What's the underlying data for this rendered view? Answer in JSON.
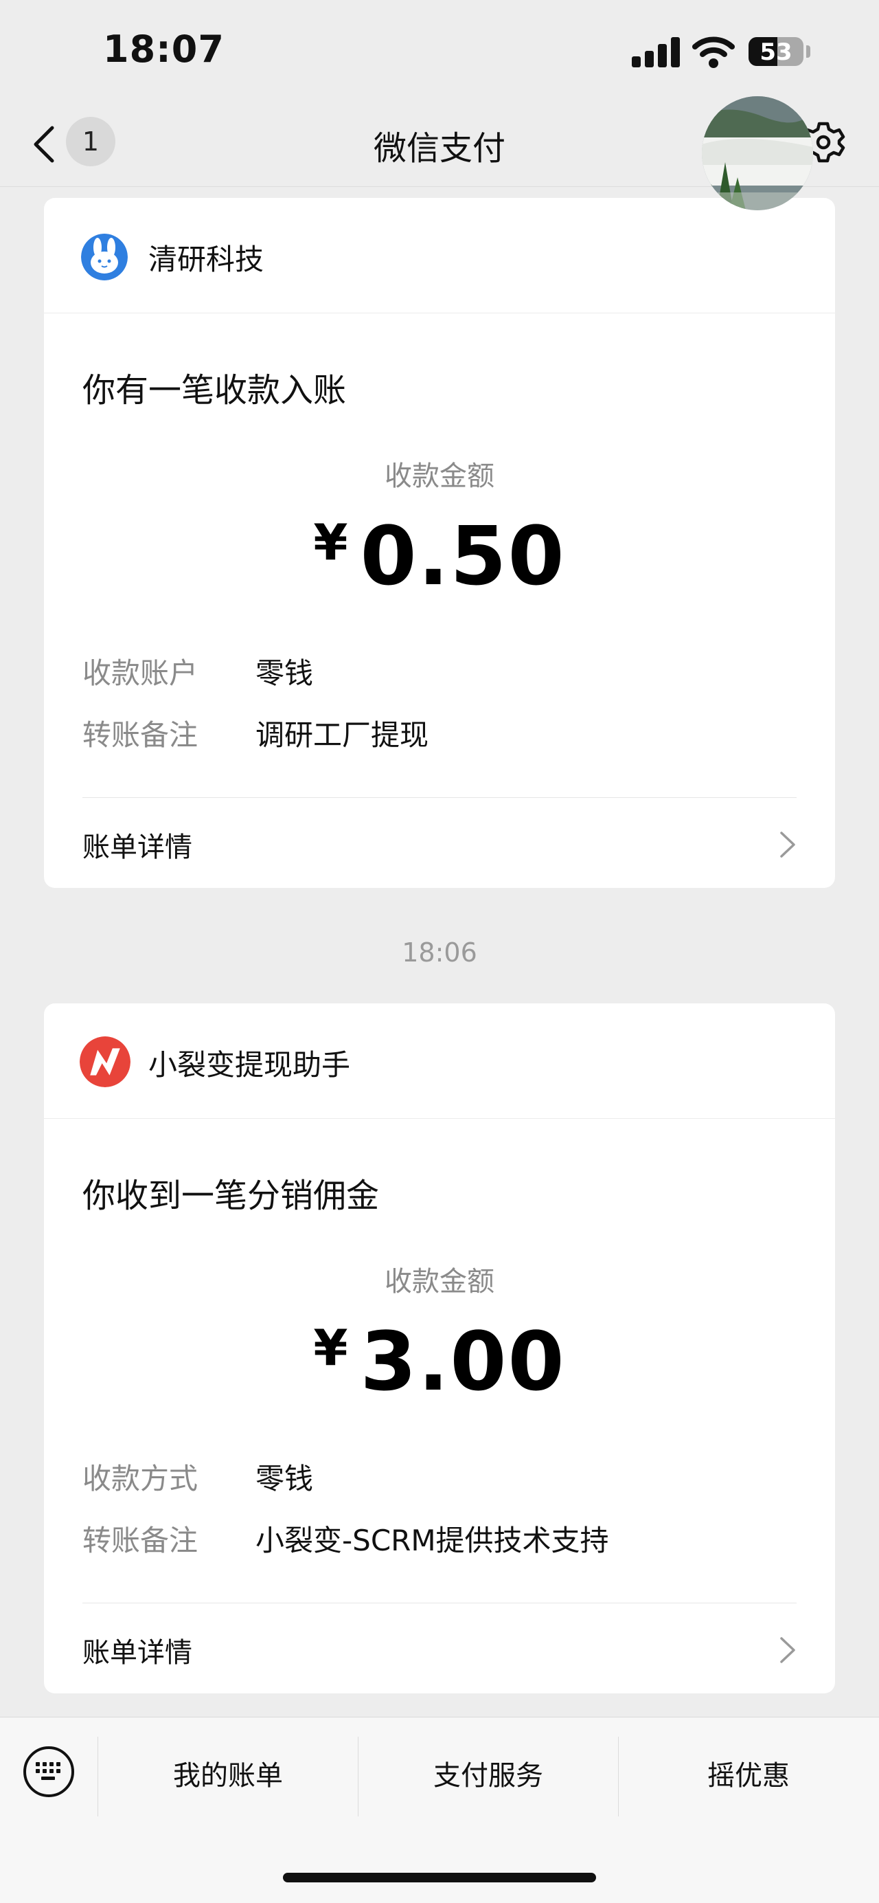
{
  "status_bar": {
    "time": "18:07",
    "battery": "53",
    "battery_level": 0.53
  },
  "nav": {
    "unread_count": "1",
    "title": "微信支付"
  },
  "messages": [
    {
      "sender": "清研科技",
      "headline": "你有一笔收款入账",
      "amount_label": "收款金额",
      "currency": "¥",
      "amount": "0.50",
      "rows": [
        {
          "key": "收款账户",
          "value": "零钱"
        },
        {
          "key": "转账备注",
          "value": "调研工厂提现"
        }
      ],
      "detail_label": "账单详情"
    },
    {
      "sender": "小裂变提现助手",
      "headline": "你收到一笔分销佣金",
      "amount_label": "收款金额",
      "currency": "¥",
      "amount": "3.00",
      "rows": [
        {
          "key": "收款方式",
          "value": "零钱"
        },
        {
          "key": "转账备注",
          "value": "小裂变-SCRM提供技术支持"
        }
      ],
      "detail_label": "账单详情"
    }
  ],
  "time_divider": "18:06",
  "bottom_menu": {
    "items": [
      "我的账单",
      "支付服务",
      "摇优惠"
    ]
  },
  "colors": {
    "background": "#ededed",
    "card": "#ffffff",
    "muted": "#8a8a8a",
    "brand_red": "#e8443a",
    "brand_blue": "#2f7fe0"
  }
}
